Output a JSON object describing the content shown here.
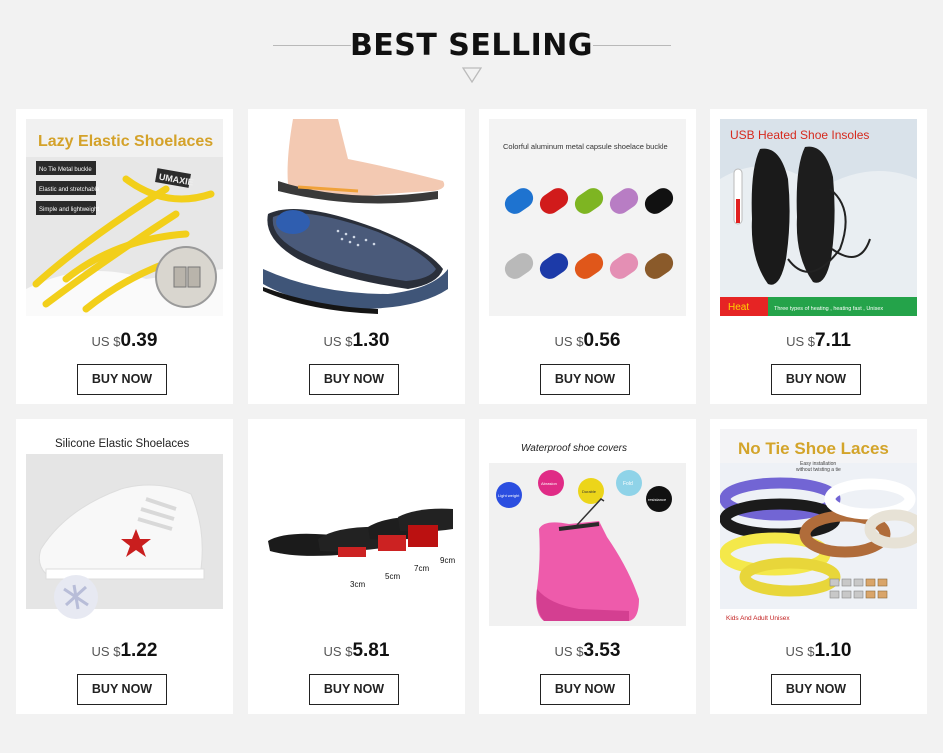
{
  "header": {
    "title": "BEST SELLING"
  },
  "products": [
    {
      "caption": "Lazy Elastic Shoelaces",
      "features": [
        "No Tie Metal buckle",
        "Elastic and stretchable",
        "Simple and lightweight"
      ],
      "brand_text": "UMAXIE",
      "currency": "US $",
      "price": "0.39",
      "button": "BUY NOW"
    },
    {
      "currency": "US $",
      "price": "1.30",
      "button": "BUY NOW"
    },
    {
      "caption": "Colorful aluminum metal capsule shoelace buckle",
      "currency": "US $",
      "price": "0.56",
      "button": "BUY NOW"
    },
    {
      "caption": "USB Heated Shoe Insoles",
      "banner_left": "Heat",
      "banner_right": "Three types of heating , heating fast , Unisex",
      "currency": "US $",
      "price": "7.11",
      "button": "BUY NOW"
    },
    {
      "caption": "Silicone Elastic Shoelaces",
      "currency": "US $",
      "price": "1.22",
      "button": "BUY NOW"
    },
    {
      "sizes": [
        "3cm",
        "5cm",
        "7cm",
        "9cm"
      ],
      "currency": "US $",
      "price": "5.81",
      "button": "BUY NOW"
    },
    {
      "caption": "Waterproof shoe covers",
      "bubbles": [
        "Light weight",
        "Abrasion",
        "Durable",
        "Fold",
        "resistance"
      ],
      "currency": "US $",
      "price": "3.53",
      "button": "BUY NOW"
    },
    {
      "caption": "No Tie Shoe Laces",
      "subcaption1": "Easy installation",
      "subcaption2": "without twisting a tie",
      "footer": "Kids And Adult Unisex",
      "currency": "US $",
      "price": "1.10",
      "button": "BUY NOW"
    }
  ],
  "colors": {
    "background": "#f2f2f2",
    "card": "#ffffff",
    "text": "#111111"
  }
}
